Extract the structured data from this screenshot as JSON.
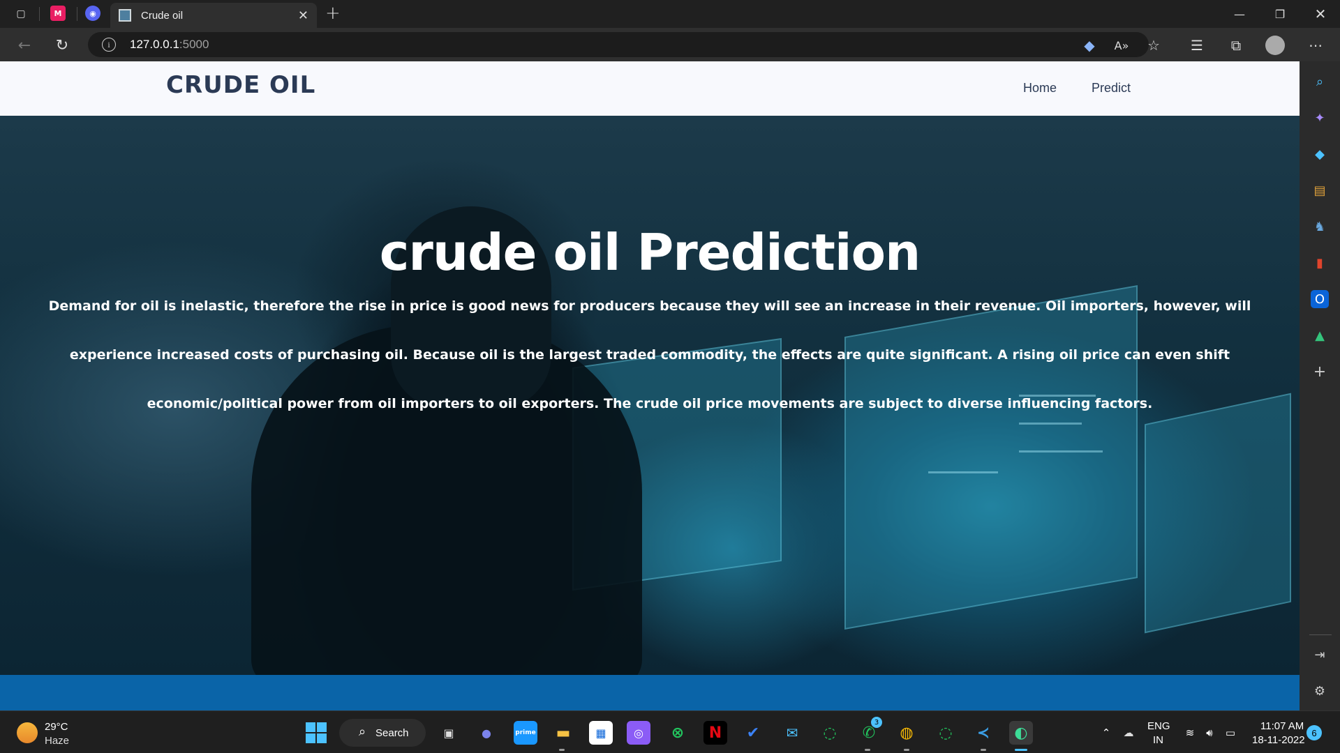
{
  "browser": {
    "tab_title": "Crude oil",
    "url_host": "127.0.0.1",
    "url_port": ":5000",
    "pinned_tabs": [
      "M",
      "discord"
    ]
  },
  "site": {
    "logo": "CRUDE OIL",
    "nav": [
      "Home",
      "Predict"
    ],
    "hero_title": "crude oil Prediction",
    "hero_text": "Demand for oil is inelastic, therefore the rise in price is good news for producers because they will see an increase in their revenue. Oil importers, however, will experience increased costs of purchasing oil. Because oil is the largest traded commodity, the effects are quite significant. A rising oil price can even shift economic/political power from oil importers to oil exporters. The crude oil price movements are subject to diverse influencing factors."
  },
  "taskbar": {
    "weather_temp": "29°C",
    "weather_condition": "Haze",
    "search_label": "Search",
    "whatsapp_badge": "3",
    "language": "ENG",
    "region": "IN",
    "time": "11:07 AM",
    "date": "18-11-2022",
    "notification_count": "6"
  },
  "colors": {
    "brand_text": "#2b3a55",
    "footer_bar": "#0a64a8",
    "accent": "#4cc2ff"
  }
}
